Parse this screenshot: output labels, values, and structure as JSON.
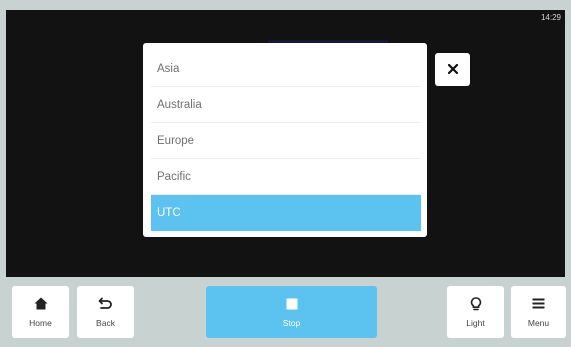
{
  "status": {
    "time": "14:29"
  },
  "dialog": {
    "items": [
      {
        "label": "Asia",
        "selected": false
      },
      {
        "label": "Australia",
        "selected": false
      },
      {
        "label": "Europe",
        "selected": false
      },
      {
        "label": "Pacific",
        "selected": false
      },
      {
        "label": "UTC",
        "selected": true
      }
    ],
    "close_icon": "close-icon"
  },
  "bottom_bar": {
    "home": {
      "label": "Home",
      "icon": "home-icon"
    },
    "back": {
      "label": "Back",
      "icon": "back-icon"
    },
    "stop": {
      "label": "Stop",
      "icon": "stop-icon"
    },
    "light": {
      "label": "Light",
      "icon": "lightbulb-icon"
    },
    "menu": {
      "label": "Menu",
      "icon": "menu-icon"
    }
  },
  "colors": {
    "accent": "#5cc3f0",
    "display_background": "#121212",
    "bar_background": "#c8d2d1"
  }
}
